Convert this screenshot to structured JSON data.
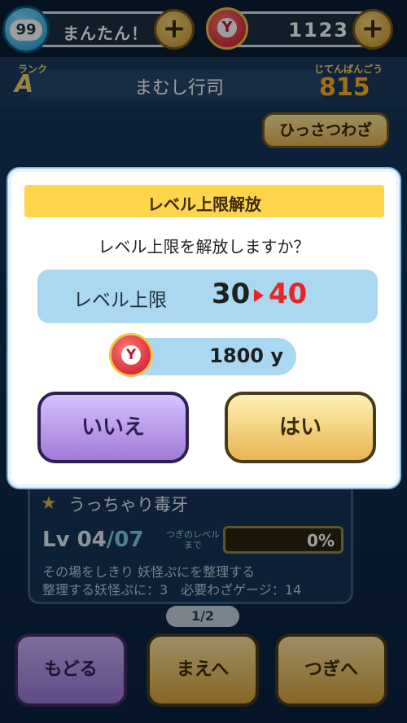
{
  "header": {
    "stamina_value": "99",
    "stamina_label": "まんたん！",
    "money_value": "1123",
    "plus": "+",
    "coin_glyph": "Y"
  },
  "yokai": {
    "rank_key": "ランク",
    "rank_value": "A",
    "name": "まむし行司",
    "number_key": "じてんばんごう",
    "number_value": "815"
  },
  "skill_button": "ひっさつわざ",
  "move": {
    "name": "うっちゃり毒牙",
    "level_prefix": "Lv",
    "level_current": "04",
    "level_max": "/07",
    "next_label": "つぎのレベルまで",
    "gauge_percent": 0,
    "gauge_text": "0%",
    "description_line1": "その場をしきり 妖怪ぷにを整理する",
    "description_line2": "整理する妖怪ぷに：3　必要わざゲージ：14"
  },
  "pager": "1/2",
  "nav": {
    "back": "もどる",
    "prev": "まえへ",
    "next": "つぎへ"
  },
  "modal": {
    "title": "レベル上限解放",
    "question": "レベル上限を解放しますか？",
    "limit_label": "レベル上限",
    "limit_from": "30",
    "limit_to": "40",
    "cost": "1800 y",
    "no": "いいえ",
    "yes": "はい",
    "accent_color": "#ffd54c",
    "highlight_color": "#e8232a"
  }
}
